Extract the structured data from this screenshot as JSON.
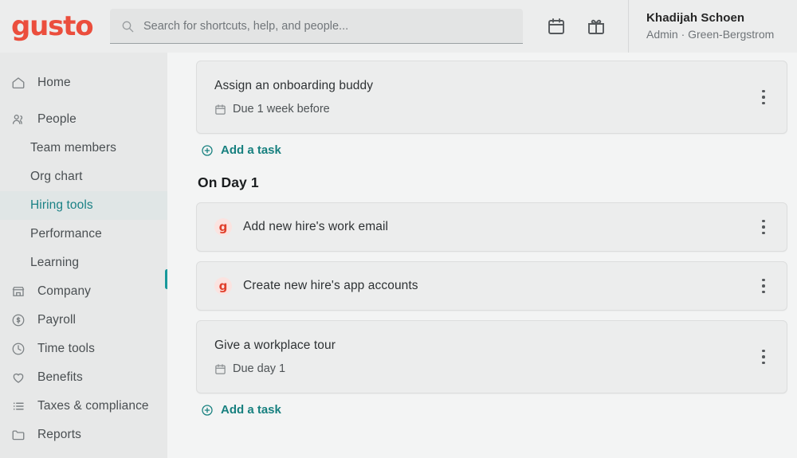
{
  "header": {
    "logo_text": "gusto",
    "search": {
      "placeholder": "Search for shortcuts, help, and people...",
      "value": ""
    },
    "icons": [
      {
        "name": "calendar-icon",
        "label": "Calendar"
      },
      {
        "name": "gift-icon",
        "label": "Gift"
      }
    ],
    "user": {
      "name": "Khadijah Schoen",
      "role": "Admin · Green-Bergstrom"
    }
  },
  "sidebar": {
    "items": [
      {
        "label": "Home",
        "icon": "home-icon",
        "type": "top",
        "active": false
      },
      {
        "label": "People",
        "icon": "people-icon",
        "type": "top",
        "active": false
      },
      {
        "label": "Team members",
        "icon": "",
        "type": "sub",
        "active": false
      },
      {
        "label": "Org chart",
        "icon": "",
        "type": "sub",
        "active": false
      },
      {
        "label": "Hiring tools",
        "icon": "",
        "type": "sub",
        "active": true
      },
      {
        "label": "Performance",
        "icon": "",
        "type": "sub",
        "active": false
      },
      {
        "label": "Learning",
        "icon": "",
        "type": "sub",
        "active": false
      },
      {
        "label": "Company",
        "icon": "company-icon",
        "type": "top",
        "active": false
      },
      {
        "label": "Payroll",
        "icon": "payroll-icon",
        "type": "top",
        "active": false
      },
      {
        "label": "Time tools",
        "icon": "clock-icon",
        "type": "top",
        "active": false
      },
      {
        "label": "Benefits",
        "icon": "heart-icon",
        "type": "top",
        "active": false
      },
      {
        "label": "Taxes & compliance",
        "icon": "list-icon",
        "type": "top",
        "active": false
      },
      {
        "label": "Reports",
        "icon": "folder-icon",
        "type": "top",
        "active": false
      }
    ]
  },
  "main": {
    "top_card": {
      "title": "Assign an onboarding buddy",
      "due": "Due 1 week before"
    },
    "add_task_top": "Add a task",
    "section_title": "On Day 1",
    "day1_cards": [
      {
        "title": "Add new hire's work email",
        "badge": "g",
        "due": ""
      },
      {
        "title": "Create new hire's app accounts",
        "badge": "g",
        "due": ""
      },
      {
        "title": "Give a workplace tour",
        "badge": "",
        "due": "Due day 1"
      }
    ],
    "add_task_bottom": "Add a task"
  },
  "colors": {
    "brand_red": "#eb4e3d",
    "accent_teal": "#17807f",
    "active_marker": "#18989b",
    "badge_bg": "#fbe3e0"
  }
}
